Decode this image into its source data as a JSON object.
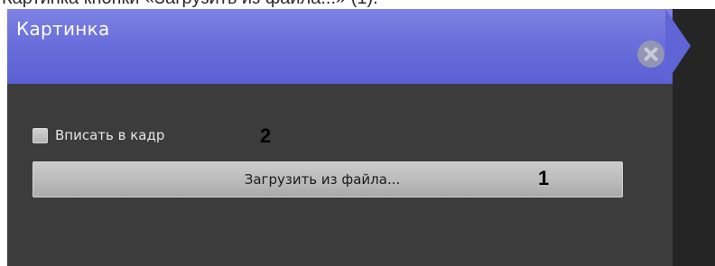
{
  "caption_fragment": "Картинка кнопки «Загрузить из файла...» (1).",
  "panel": {
    "title": "Картинка",
    "close_icon": "close-icon",
    "fit_checkbox": {
      "label": "Вписать в кадр",
      "checked": false
    },
    "load_button": {
      "label": "Загрузить из файла..."
    }
  },
  "markers": {
    "one": "1",
    "two": "2"
  },
  "colors": {
    "header": "#6a6fdc",
    "panel_bg": "#3c3c3c",
    "close_btn": "#9396b2",
    "button_bg": "#bdbdbd"
  }
}
